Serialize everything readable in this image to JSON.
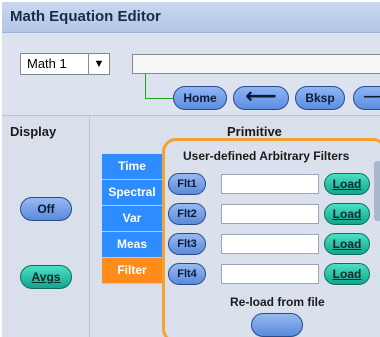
{
  "window": {
    "title": "Math Equation Editor"
  },
  "math_source": {
    "selected": "Math 1",
    "arrow": "▼"
  },
  "equation": {
    "value": ""
  },
  "nav": {
    "home_label": "Home",
    "back_arrow_label": "⟵",
    "bksp_label": "Bksp",
    "more_label": "—"
  },
  "display": {
    "title": "Display",
    "off_label": "Off",
    "avgs_label": "Avgs"
  },
  "primitive": {
    "title": "Primitive",
    "tabs": [
      {
        "label": "Time"
      },
      {
        "label": "Spectral"
      },
      {
        "label": "Var"
      },
      {
        "label": "Meas"
      },
      {
        "label": "Filter"
      }
    ],
    "active_tab": "Filter"
  },
  "filters": {
    "title": "User-defined Arbitrary Filters",
    "rows": [
      {
        "label": "Flt1",
        "value": "",
        "load_label": "Load"
      },
      {
        "label": "Flt2",
        "value": "",
        "load_label": "Load"
      },
      {
        "label": "Flt3",
        "value": "",
        "load_label": "Load"
      },
      {
        "label": "Flt4",
        "value": "",
        "load_label": "Load"
      }
    ],
    "reload_title": "Re-load from file",
    "reload_button_label": ""
  },
  "colors": {
    "accent_orange": "#ff8c1a",
    "panel_border": "#f3a232",
    "tab_blue": "#2d8cff",
    "button_green": "#13a58e",
    "connector_green": "#1fa51f"
  }
}
